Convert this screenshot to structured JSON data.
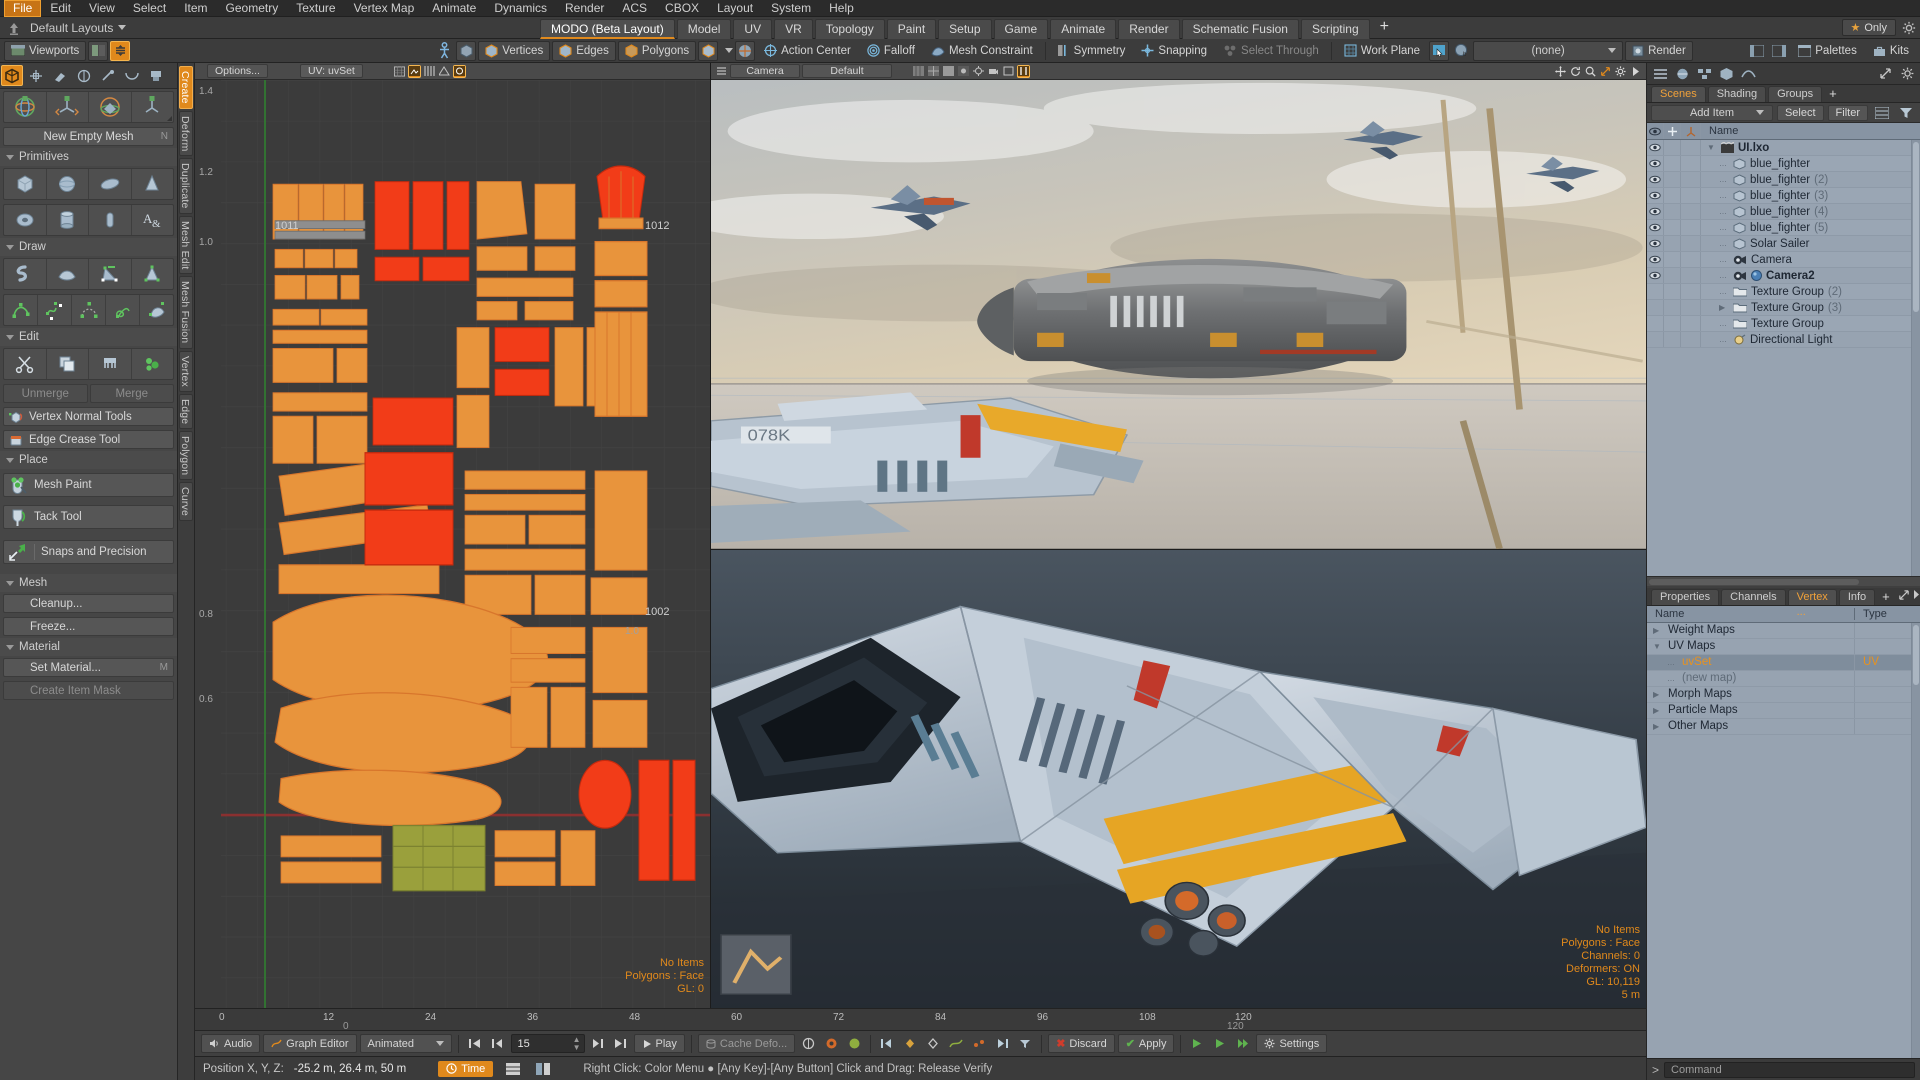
{
  "menubar": {
    "items": [
      "File",
      "Edit",
      "View",
      "Select",
      "Item",
      "Geometry",
      "Texture",
      "Vertex Map",
      "Animate",
      "Dynamics",
      "Render",
      "ACS",
      "CBOX",
      "Layout",
      "System",
      "Help"
    ],
    "active": "File"
  },
  "layoutrow": {
    "preset_label": "Default Layouts",
    "tabs": [
      "MODO (Beta Layout)",
      "Model",
      "UV",
      "VR",
      "Topology",
      "Paint",
      "Setup",
      "Game",
      "Animate",
      "Render",
      "Schematic Fusion",
      "Scripting"
    ],
    "active_tab": "MODO (Beta Layout)",
    "add_tab": "+",
    "only_label": "Only"
  },
  "toolbar1": {
    "viewports_label": "Viewports",
    "vertices_label": "Vertices",
    "edges_label": "Edges",
    "polygons_label": "Polygons",
    "action_center_label": "Action Center",
    "falloff_label": "Falloff",
    "mesh_constraint_label": "Mesh Constraint",
    "symmetry_label": "Symmetry",
    "snapping_label": "Snapping",
    "select_through_label": "Select Through",
    "work_plane_label": "Work Plane",
    "preset_dropdown": "(none)",
    "render_label": "Render",
    "palettes_label": "Palettes",
    "kits_label": "Kits"
  },
  "left_panel": {
    "vertical_tabs": [
      "Create",
      "Deform",
      "Duplicate",
      "Mesh Edit",
      "Mesh Fusion",
      "Vertex",
      "Edge",
      "Polygon",
      "Curve"
    ],
    "active_vertical_tab": "Create",
    "new_empty_mesh": "New Empty Mesh",
    "sections": {
      "primitives": "Primitives",
      "draw": "Draw",
      "edit": "Edit",
      "place": "Place",
      "mesh": "Mesh",
      "material": "Material"
    },
    "unmerge": "Unmerge",
    "merge": "Merge",
    "vertex_normal_tools": "Vertex Normal Tools",
    "edge_crease_tool": "Edge Crease Tool",
    "mesh_paint": "Mesh Paint",
    "tack_tool": "Tack Tool",
    "snaps_and_precision": "Snaps and Precision",
    "cleanup": "Cleanup...",
    "freeze": "Freeze...",
    "set_material": "Set Material...",
    "set_material_hint": "M",
    "create_item_mask": "Create Item Mask",
    "new_empty_mesh_hint": "N"
  },
  "uv_viewport": {
    "options_label": "Options...",
    "title": "UV: uvSet",
    "axis_labels_left": [
      "1.4",
      "1.2",
      "1.0",
      "0.8",
      "0.6"
    ],
    "tile_labels": [
      "1011",
      "1012",
      "1002"
    ],
    "axis_small": [
      "1.0",
      "1.0"
    ],
    "overlay": {
      "line1": "No Items",
      "line2": "Polygons : Face",
      "line3": "GL: 0"
    }
  },
  "persp_viewport": {
    "camera_tab": "Camera",
    "style_tab": "Default",
    "overlay": {
      "line1": "No Items",
      "line2": "Polygons : Face",
      "line3": "Channels: 0",
      "line4": "Deformers: ON",
      "line5": "GL: 10,119",
      "line6": "5 m"
    }
  },
  "timeline": {
    "top_ticks": [
      "0",
      "12",
      "24",
      "36",
      "48",
      "60",
      "72",
      "84",
      "96",
      "108",
      "120"
    ],
    "bottom_ticks": [
      "0",
      "120"
    ],
    "audio": "Audio",
    "graph_editor": "Graph Editor",
    "animated": "Animated",
    "frame_value": "15",
    "play": "Play",
    "cache_deform": "Cache Defo...",
    "discard": "Discard",
    "apply": "Apply",
    "settings": "Settings"
  },
  "statusbar": {
    "position_label": "Position X, Y, Z:",
    "position_value": "-25.2 m, 26.4 m, 50 m",
    "time_label": "Time",
    "hint": "Right Click: Color Menu ● [Any Key]-[Any Button] Click and Drag: Release Verify"
  },
  "right_panel": {
    "tabs": [
      "Scenes",
      "Shading",
      "Groups"
    ],
    "active_tab": "Scenes",
    "add_tab": "+",
    "add_item": "Add Item",
    "select": "Select",
    "filter": "Filter",
    "tree_header_name": "Name",
    "tree": [
      {
        "label": "UI.lxo",
        "suffix": "",
        "indent": 0,
        "icon": "scene-icon",
        "bold": true,
        "expander": "down",
        "eye": true
      },
      {
        "label": "blue_fighter",
        "suffix": "",
        "indent": 1,
        "icon": "mesh-icon",
        "bold": false,
        "expander": "none",
        "eye": true
      },
      {
        "label": "blue_fighter",
        "suffix": "(2)",
        "indent": 1,
        "icon": "mesh-icon",
        "bold": false,
        "expander": "none",
        "eye": true
      },
      {
        "label": "blue_fighter",
        "suffix": "(3)",
        "indent": 1,
        "icon": "mesh-icon",
        "bold": false,
        "expander": "none",
        "eye": true
      },
      {
        "label": "blue_fighter",
        "suffix": "(4)",
        "indent": 1,
        "icon": "mesh-icon",
        "bold": false,
        "expander": "none",
        "eye": true
      },
      {
        "label": "blue_fighter",
        "suffix": "(5)",
        "indent": 1,
        "icon": "mesh-icon",
        "bold": false,
        "expander": "none",
        "eye": true
      },
      {
        "label": "Solar Sailer",
        "suffix": "",
        "indent": 1,
        "icon": "mesh-icon",
        "bold": false,
        "expander": "none",
        "eye": true
      },
      {
        "label": "Camera",
        "suffix": "",
        "indent": 1,
        "icon": "camera-icon",
        "bold": false,
        "expander": "none",
        "eye": true
      },
      {
        "label": "Camera2",
        "suffix": "",
        "indent": 1,
        "icon": "camera-icon",
        "bold": true,
        "expander": "none",
        "eye": true
      },
      {
        "label": "Texture Group",
        "suffix": "(2)",
        "indent": 1,
        "icon": "folder-icon",
        "bold": false,
        "expander": "none",
        "eye": false
      },
      {
        "label": "Texture Group",
        "suffix": "(3)",
        "indent": 1,
        "icon": "folder-icon",
        "bold": false,
        "expander": "right",
        "eye": false
      },
      {
        "label": "Texture Group",
        "suffix": "",
        "indent": 1,
        "icon": "folder-icon",
        "bold": false,
        "expander": "none",
        "eye": false
      },
      {
        "label": "Directional Light",
        "suffix": "",
        "indent": 1,
        "icon": "light-icon",
        "bold": false,
        "expander": "none",
        "eye": false
      }
    ],
    "lower_tabs": [
      "Properties",
      "Channels",
      "Vertex  ...",
      "Info"
    ],
    "lower_active_tab": "Vertex  ...",
    "lower_add_tab": "+",
    "vm_header_name": "Name",
    "vm_header_type": "Type",
    "vertex_maps": [
      {
        "label": "Weight Maps",
        "type": "",
        "indent": 0,
        "expander": "right",
        "selected": false,
        "dim": false
      },
      {
        "label": "UV Maps",
        "type": "",
        "indent": 0,
        "expander": "down",
        "selected": false,
        "dim": false
      },
      {
        "label": "uvSet",
        "type": "UV",
        "indent": 1,
        "expander": "none",
        "selected": true,
        "dim": false
      },
      {
        "label": "(new map)",
        "type": "",
        "indent": 1,
        "expander": "none",
        "selected": false,
        "dim": true
      },
      {
        "label": "Morph Maps",
        "type": "",
        "indent": 0,
        "expander": "right",
        "selected": false,
        "dim": false
      },
      {
        "label": "Particle Maps",
        "type": "",
        "indent": 0,
        "expander": "right",
        "selected": false,
        "dim": false
      },
      {
        "label": "Other Maps",
        "type": "",
        "indent": 0,
        "expander": "right",
        "selected": false,
        "dim": false
      }
    ],
    "command_placeholder": "Command"
  },
  "colors": {
    "accent": "#e0891c",
    "panel": "#3f3f3f",
    "tree_bg": "#97a3b1",
    "uv_shell": "#e8943c",
    "uv_selected": "#f23c18"
  }
}
